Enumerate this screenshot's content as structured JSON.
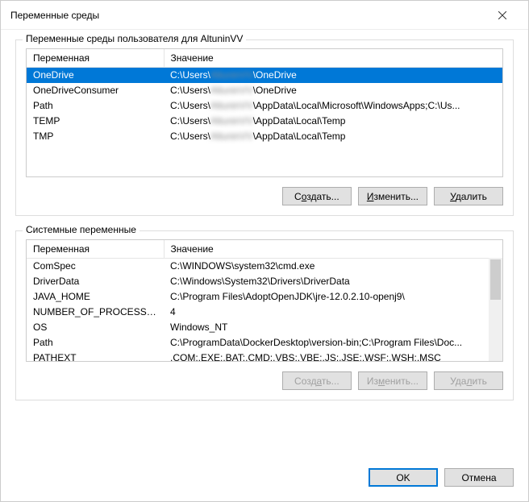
{
  "window": {
    "title": "Переменные среды"
  },
  "user_group": {
    "label_prefix": "Переменные среды пользователя для ",
    "username": "AltuninVV",
    "columns": {
      "variable": "Переменная",
      "value": "Значение"
    },
    "rows": [
      {
        "name": "OneDrive",
        "value_prefix": "C:\\Users\\",
        "value_blur": "AltuninVV",
        "value_suffix": "\\OneDrive",
        "selected": true
      },
      {
        "name": "OneDriveConsumer",
        "value_prefix": "C:\\Users\\",
        "value_blur": "AltuninVV",
        "value_suffix": "\\OneDrive"
      },
      {
        "name": "Path",
        "value_prefix": "C:\\Users\\",
        "value_blur": "AltuninVV",
        "value_suffix": "\\AppData\\Local\\Microsoft\\WindowsApps;C:\\Us..."
      },
      {
        "name": "TEMP",
        "value_prefix": "C:\\Users\\",
        "value_blur": "AltuninVV",
        "value_suffix": "\\AppData\\Local\\Temp"
      },
      {
        "name": "TMP",
        "value_prefix": "C:\\Users\\",
        "value_blur": "AltuninVV",
        "value_suffix": "\\AppData\\Local\\Temp"
      }
    ],
    "buttons": {
      "new_pre": "С",
      "new_u": "о",
      "new_post": "здать...",
      "edit_pre": "",
      "edit_u": "И",
      "edit_post": "зменить...",
      "delete_pre": "",
      "delete_u": "У",
      "delete_post": "далить"
    }
  },
  "system_group": {
    "label": "Системные переменные",
    "columns": {
      "variable": "Переменная",
      "value": "Значение"
    },
    "rows": [
      {
        "name": "ComSpec",
        "value": "C:\\WINDOWS\\system32\\cmd.exe"
      },
      {
        "name": "DriverData",
        "value": "C:\\Windows\\System32\\Drivers\\DriverData"
      },
      {
        "name": "JAVA_HOME",
        "value": "C:\\Program Files\\AdoptOpenJDK\\jre-12.0.2.10-openj9\\"
      },
      {
        "name": "NUMBER_OF_PROCESSORS",
        "value": "4"
      },
      {
        "name": "OS",
        "value": "Windows_NT"
      },
      {
        "name": "Path",
        "value": "C:\\ProgramData\\DockerDesktop\\version-bin;C:\\Program Files\\Doc..."
      },
      {
        "name": "PATHEXT",
        "value": ".COM;.EXE;.BAT;.CMD;.VBS;.VBE;.JS;.JSE;.WSF;.WSH;.MSC"
      }
    ],
    "buttons": {
      "new_pre": "Созд",
      "new_u": "а",
      "new_post": "ть...",
      "edit_pre": "Из",
      "edit_u": "м",
      "edit_post": "енить...",
      "delete_pre": "Уда",
      "delete_u": "л",
      "delete_post": "ить"
    }
  },
  "footer": {
    "ok": "OK",
    "cancel": "Отмена"
  }
}
